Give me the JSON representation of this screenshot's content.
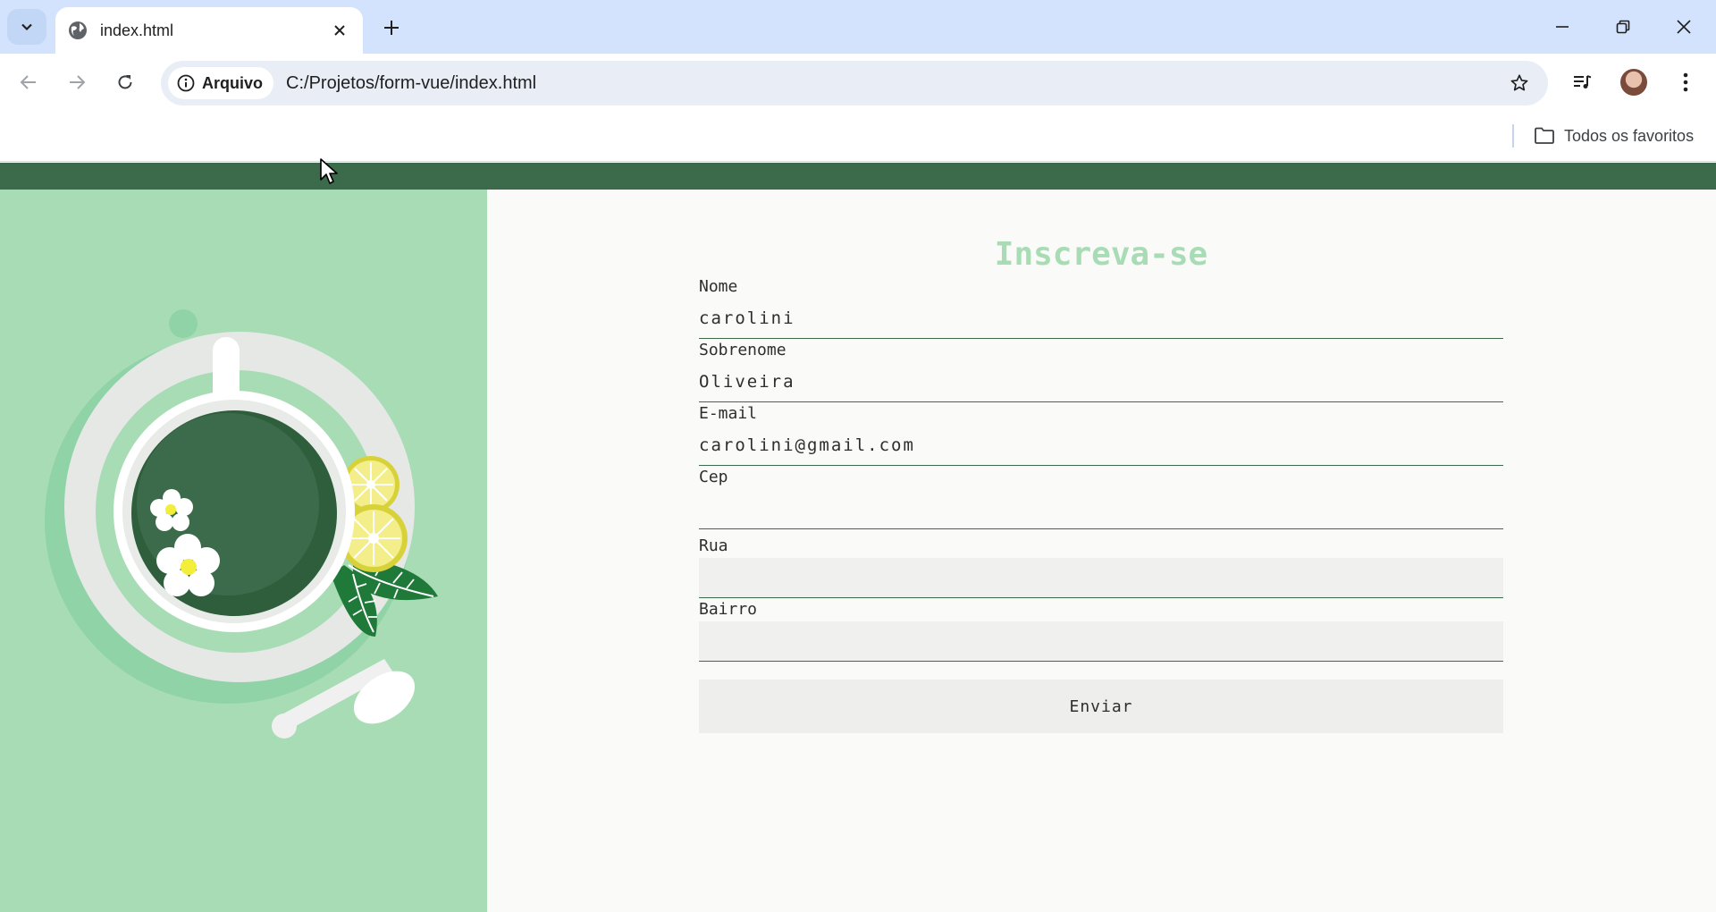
{
  "browser": {
    "tab": {
      "title": "index.html"
    },
    "address": {
      "chip_label": "Arquivo",
      "url": "C:/Projetos/form-vue/index.html"
    },
    "bookmarks": {
      "all_label": "Todos os favoritos"
    }
  },
  "colors": {
    "topbar": "#3b6b4b",
    "panel": "#a8dcb5",
    "title": "#a8dcb5",
    "input_border": "#3b6b4b"
  },
  "form": {
    "title": "Inscreva-se",
    "fields": [
      {
        "label": "Nome",
        "value": "carolini"
      },
      {
        "label": "Sobrenome",
        "value": "Oliveira"
      },
      {
        "label": "E-mail",
        "value": "carolini@gmail.com"
      },
      {
        "label": "Cep",
        "value": ""
      },
      {
        "label": "Rua",
        "value": ""
      },
      {
        "label": "Bairro",
        "value": ""
      }
    ],
    "submit_label": "Enviar"
  },
  "illustration": {
    "subject": "tea-cup-with-flowers-lemons-and-spoon"
  }
}
